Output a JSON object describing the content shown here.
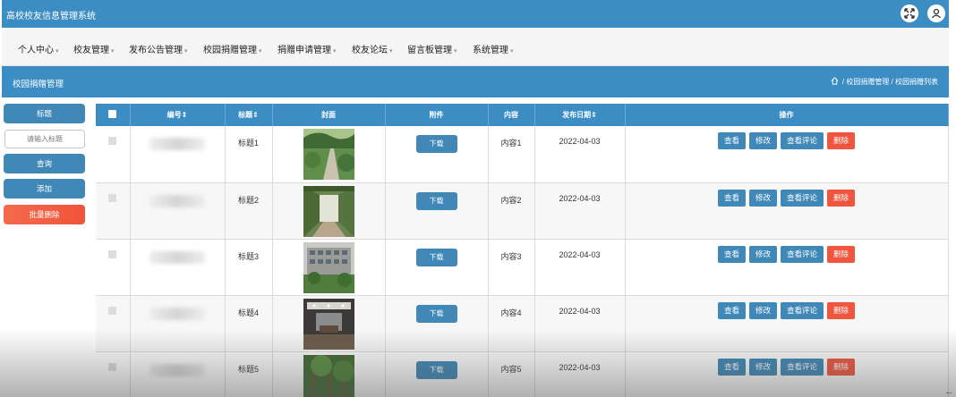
{
  "app": {
    "title": "高校校友信息管理系统"
  },
  "topbar_icons": [
    "fullscreen-icon",
    "user-icon"
  ],
  "nav": [
    {
      "label": "个人中心"
    },
    {
      "label": "校友管理"
    },
    {
      "label": "发布公告管理"
    },
    {
      "label": "校园捐赠管理"
    },
    {
      "label": "捐赠申请管理"
    },
    {
      "label": "校友论坛"
    },
    {
      "label": "留言板管理"
    },
    {
      "label": "系统管理"
    }
  ],
  "page": {
    "title": "校园捐赠管理",
    "breadcrumb": [
      "校园捐赠管理",
      "校园捐赠列表"
    ]
  },
  "sidebar": {
    "field_label": "标题",
    "search_placeholder": "请输入标题",
    "query_label": "查询",
    "add_label": "添加",
    "batch_delete_label": "批量删除"
  },
  "table": {
    "columns": [
      "编号",
      "标题",
      "封面",
      "附件",
      "内容",
      "发布日期",
      "操作"
    ],
    "sortable": [
      "编号",
      "标题",
      "发布日期"
    ],
    "download_label": "下载",
    "actions": [
      "查看",
      "修改",
      "查看评论",
      "删除"
    ],
    "rows": [
      {
        "title": "标题1",
        "content": "内容1",
        "date": "2022-04-03",
        "cover": "path"
      },
      {
        "title": "标题2",
        "content": "内容2",
        "date": "2022-04-03",
        "cover": "corridor"
      },
      {
        "title": "标题3",
        "content": "内容3",
        "date": "2022-04-03",
        "cover": "building"
      },
      {
        "title": "标题4",
        "content": "内容4",
        "date": "2022-04-03",
        "cover": "hall"
      },
      {
        "title": "标题5",
        "content": "内容5",
        "date": "2022-04-03",
        "cover": "trees"
      }
    ]
  },
  "colors": {
    "primary": "#3c8dc3",
    "danger": "#f0553e",
    "nav_bg": "#f5f5f5"
  }
}
